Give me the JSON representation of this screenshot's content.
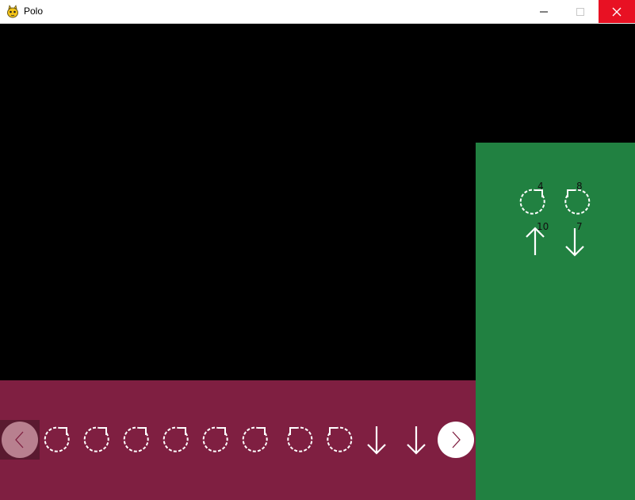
{
  "window": {
    "title": "Polo",
    "icon": "pygame-snake-icon",
    "controls": [
      "minimize-icon",
      "maximize-icon",
      "close-icon"
    ],
    "close_color": "#e81123"
  },
  "colors": {
    "viewport": "#000000",
    "program_bar": "#7f1f41",
    "palette": "#218141",
    "command_stroke": "#ffffff"
  },
  "program": {
    "commands": [
      "rotate-clockwise",
      "rotate-clockwise",
      "rotate-clockwise",
      "rotate-clockwise",
      "rotate-clockwise",
      "rotate-clockwise",
      "rotate-counterclockwise",
      "rotate-counterclockwise",
      "move-down",
      "move-down"
    ],
    "prev_icon": "chevron-left-icon",
    "next_icon": "chevron-right-icon"
  },
  "palette": {
    "items": [
      {
        "command": "rotate-clockwise",
        "count": "4"
      },
      {
        "command": "rotate-counterclockwise",
        "count": "8"
      },
      {
        "command": "move-up",
        "count": "10"
      },
      {
        "command": "move-down",
        "count": "7"
      }
    ]
  }
}
